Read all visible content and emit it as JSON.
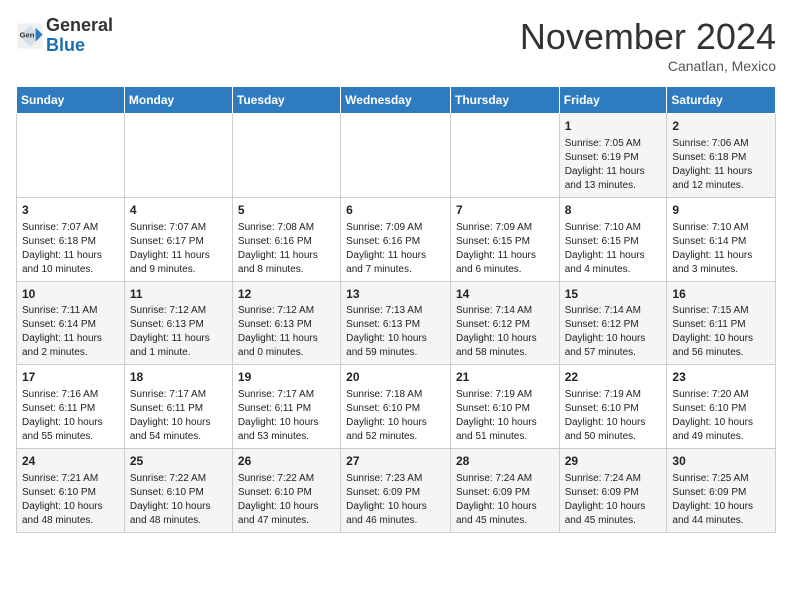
{
  "header": {
    "logo": {
      "line1": "General",
      "line2": "Blue"
    },
    "month": "November 2024",
    "location": "Canatlan, Mexico"
  },
  "weekdays": [
    "Sunday",
    "Monday",
    "Tuesday",
    "Wednesday",
    "Thursday",
    "Friday",
    "Saturday"
  ],
  "weeks": [
    [
      {
        "day": "",
        "info": ""
      },
      {
        "day": "",
        "info": ""
      },
      {
        "day": "",
        "info": ""
      },
      {
        "day": "",
        "info": ""
      },
      {
        "day": "",
        "info": ""
      },
      {
        "day": "1",
        "info": "Sunrise: 7:05 AM\nSunset: 6:19 PM\nDaylight: 11 hours and 13 minutes."
      },
      {
        "day": "2",
        "info": "Sunrise: 7:06 AM\nSunset: 6:18 PM\nDaylight: 11 hours and 12 minutes."
      }
    ],
    [
      {
        "day": "3",
        "info": "Sunrise: 7:07 AM\nSunset: 6:18 PM\nDaylight: 11 hours and 10 minutes."
      },
      {
        "day": "4",
        "info": "Sunrise: 7:07 AM\nSunset: 6:17 PM\nDaylight: 11 hours and 9 minutes."
      },
      {
        "day": "5",
        "info": "Sunrise: 7:08 AM\nSunset: 6:16 PM\nDaylight: 11 hours and 8 minutes."
      },
      {
        "day": "6",
        "info": "Sunrise: 7:09 AM\nSunset: 6:16 PM\nDaylight: 11 hours and 7 minutes."
      },
      {
        "day": "7",
        "info": "Sunrise: 7:09 AM\nSunset: 6:15 PM\nDaylight: 11 hours and 6 minutes."
      },
      {
        "day": "8",
        "info": "Sunrise: 7:10 AM\nSunset: 6:15 PM\nDaylight: 11 hours and 4 minutes."
      },
      {
        "day": "9",
        "info": "Sunrise: 7:10 AM\nSunset: 6:14 PM\nDaylight: 11 hours and 3 minutes."
      }
    ],
    [
      {
        "day": "10",
        "info": "Sunrise: 7:11 AM\nSunset: 6:14 PM\nDaylight: 11 hours and 2 minutes."
      },
      {
        "day": "11",
        "info": "Sunrise: 7:12 AM\nSunset: 6:13 PM\nDaylight: 11 hours and 1 minute."
      },
      {
        "day": "12",
        "info": "Sunrise: 7:12 AM\nSunset: 6:13 PM\nDaylight: 11 hours and 0 minutes."
      },
      {
        "day": "13",
        "info": "Sunrise: 7:13 AM\nSunset: 6:13 PM\nDaylight: 10 hours and 59 minutes."
      },
      {
        "day": "14",
        "info": "Sunrise: 7:14 AM\nSunset: 6:12 PM\nDaylight: 10 hours and 58 minutes."
      },
      {
        "day": "15",
        "info": "Sunrise: 7:14 AM\nSunset: 6:12 PM\nDaylight: 10 hours and 57 minutes."
      },
      {
        "day": "16",
        "info": "Sunrise: 7:15 AM\nSunset: 6:11 PM\nDaylight: 10 hours and 56 minutes."
      }
    ],
    [
      {
        "day": "17",
        "info": "Sunrise: 7:16 AM\nSunset: 6:11 PM\nDaylight: 10 hours and 55 minutes."
      },
      {
        "day": "18",
        "info": "Sunrise: 7:17 AM\nSunset: 6:11 PM\nDaylight: 10 hours and 54 minutes."
      },
      {
        "day": "19",
        "info": "Sunrise: 7:17 AM\nSunset: 6:11 PM\nDaylight: 10 hours and 53 minutes."
      },
      {
        "day": "20",
        "info": "Sunrise: 7:18 AM\nSunset: 6:10 PM\nDaylight: 10 hours and 52 minutes."
      },
      {
        "day": "21",
        "info": "Sunrise: 7:19 AM\nSunset: 6:10 PM\nDaylight: 10 hours and 51 minutes."
      },
      {
        "day": "22",
        "info": "Sunrise: 7:19 AM\nSunset: 6:10 PM\nDaylight: 10 hours and 50 minutes."
      },
      {
        "day": "23",
        "info": "Sunrise: 7:20 AM\nSunset: 6:10 PM\nDaylight: 10 hours and 49 minutes."
      }
    ],
    [
      {
        "day": "24",
        "info": "Sunrise: 7:21 AM\nSunset: 6:10 PM\nDaylight: 10 hours and 48 minutes."
      },
      {
        "day": "25",
        "info": "Sunrise: 7:22 AM\nSunset: 6:10 PM\nDaylight: 10 hours and 48 minutes."
      },
      {
        "day": "26",
        "info": "Sunrise: 7:22 AM\nSunset: 6:10 PM\nDaylight: 10 hours and 47 minutes."
      },
      {
        "day": "27",
        "info": "Sunrise: 7:23 AM\nSunset: 6:09 PM\nDaylight: 10 hours and 46 minutes."
      },
      {
        "day": "28",
        "info": "Sunrise: 7:24 AM\nSunset: 6:09 PM\nDaylight: 10 hours and 45 minutes."
      },
      {
        "day": "29",
        "info": "Sunrise: 7:24 AM\nSunset: 6:09 PM\nDaylight: 10 hours and 45 minutes."
      },
      {
        "day": "30",
        "info": "Sunrise: 7:25 AM\nSunset: 6:09 PM\nDaylight: 10 hours and 44 minutes."
      }
    ]
  ]
}
